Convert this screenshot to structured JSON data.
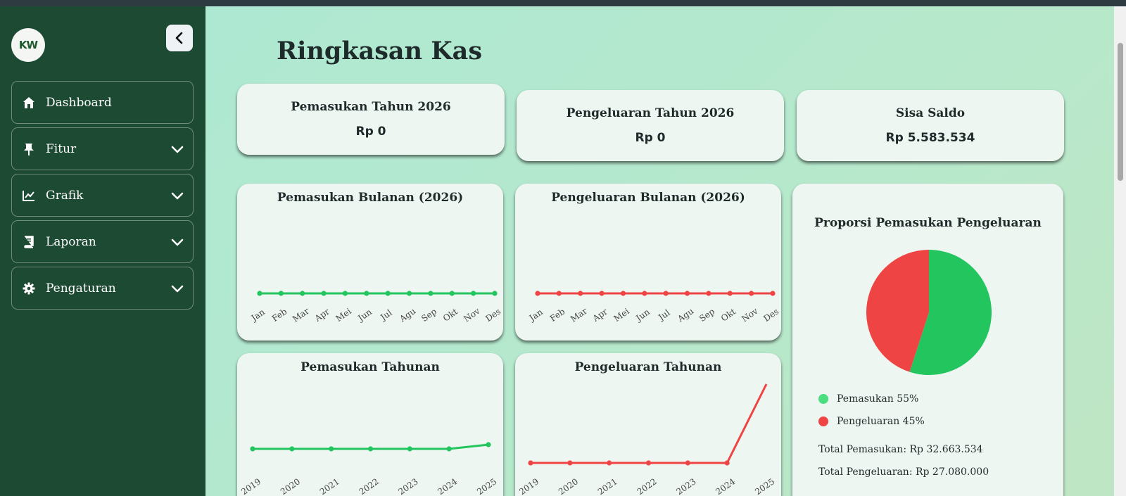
{
  "sidebar": {
    "logo_text": "KW",
    "items": [
      {
        "label": "Dashboard",
        "icon": "home-icon"
      },
      {
        "label": "Fitur",
        "icon": "pin-icon"
      },
      {
        "label": "Grafik",
        "icon": "chart-line-icon"
      },
      {
        "label": "Laporan",
        "icon": "book-icon"
      },
      {
        "label": "Pengaturan",
        "icon": "gear-icon"
      }
    ]
  },
  "page_title": "Ringkasan Kas",
  "stats": {
    "income": {
      "title": "Pemasukan Tahun 2026",
      "value": "Rp 0"
    },
    "expense": {
      "title": "Pengeluaran Tahun 2026",
      "value": "Rp 0"
    },
    "balance": {
      "title": "Sisa Saldo",
      "value": "Rp 5.583.534"
    }
  },
  "colors": {
    "income": "#22c55e",
    "expense": "#ef4444",
    "sidebar": "#1d4a33"
  },
  "chart_data": [
    {
      "type": "line",
      "title": "Pemasukan Bulanan (2026)",
      "x": [
        "Jan",
        "Feb",
        "Mar",
        "Apr",
        "Mei",
        "Jun",
        "Jul",
        "Agu",
        "Sep",
        "Okt",
        "Nov",
        "Des"
      ],
      "series": [
        {
          "values": [
            0,
            0,
            0,
            0,
            0,
            0,
            0,
            0,
            0,
            0,
            0,
            0
          ],
          "color": "#22c55e"
        }
      ]
    },
    {
      "type": "line",
      "title": "Pengeluaran Bulanan (2026)",
      "x": [
        "Jan",
        "Feb",
        "Mar",
        "Apr",
        "Mei",
        "Jun",
        "Jul",
        "Agu",
        "Sep",
        "Okt",
        "Nov",
        "Des"
      ],
      "series": [
        {
          "values": [
            0,
            0,
            0,
            0,
            0,
            0,
            0,
            0,
            0,
            0,
            0,
            0
          ],
          "color": "#ef4444"
        }
      ]
    },
    {
      "type": "line",
      "title": "Pemasukan Tahunan",
      "x": [
        "2019",
        "2020",
        "2021",
        "2022",
        "2023",
        "2024",
        "2025"
      ],
      "series": [
        {
          "values": [
            0,
            0,
            0,
            0,
            0,
            0,
            1
          ],
          "color": "#22c55e"
        }
      ]
    },
    {
      "type": "line",
      "title": "Pengeluaran Tahunan",
      "x": [
        "2019",
        "2020",
        "2021",
        "2022",
        "2023",
        "2024",
        "2025"
      ],
      "series": [
        {
          "values": [
            0,
            0,
            0,
            0,
            0,
            0,
            1
          ],
          "color": "#ef4444"
        }
      ]
    },
    {
      "type": "pie",
      "title": "Proporsi Pemasukan Pengeluaran",
      "categories": [
        "Pemasukan",
        "Pengeluaran"
      ],
      "values": [
        55,
        45
      ],
      "colors": [
        "#22c55e",
        "#ef4444"
      ],
      "legend": [
        "Pemasukan 55%",
        "Pengeluaran 45%"
      ]
    }
  ],
  "totals": {
    "income": "Total Pemasukan: Rp 32.663.534",
    "expense": "Total Pengeluaran: Rp 27.080.000"
  }
}
